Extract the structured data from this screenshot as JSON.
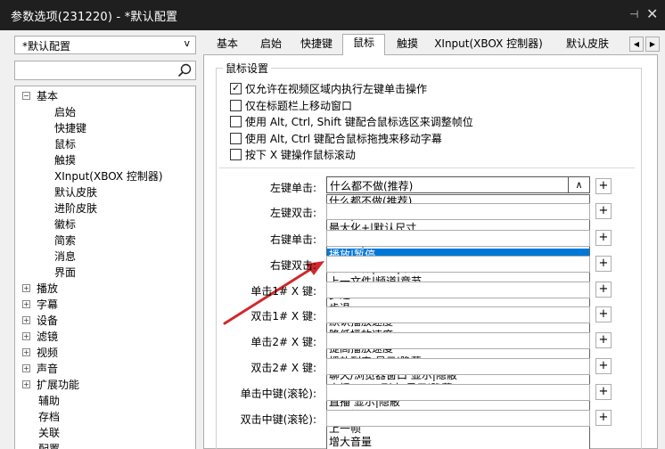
{
  "window": {
    "title": "参数选项(231220) - *默认配置",
    "pin_glyph": "⊣",
    "close_glyph": "✕"
  },
  "left": {
    "preset": "*默认配置",
    "search_placeholder": "",
    "tree": [
      {
        "label": "基本",
        "level": 0,
        "expander": "−"
      },
      {
        "label": "启始",
        "level": 2
      },
      {
        "label": "快捷键",
        "level": 2
      },
      {
        "label": "鼠标",
        "level": 2
      },
      {
        "label": "触摸",
        "level": 2
      },
      {
        "label": "XInput(XBOX 控制器)",
        "level": 2
      },
      {
        "label": "默认皮肤",
        "level": 2
      },
      {
        "label": "进阶皮肤",
        "level": 2
      },
      {
        "label": "徽标",
        "level": 2
      },
      {
        "label": "简索",
        "level": 2
      },
      {
        "label": "消息",
        "level": 2
      },
      {
        "label": "界面",
        "level": 2
      },
      {
        "label": "播放",
        "level": 0,
        "expander": "+"
      },
      {
        "label": "字幕",
        "level": 0,
        "expander": "+"
      },
      {
        "label": "设备",
        "level": 0,
        "expander": "+"
      },
      {
        "label": "滤镜",
        "level": 0,
        "expander": "+"
      },
      {
        "label": "视频",
        "level": 0,
        "expander": "+"
      },
      {
        "label": "声音",
        "level": 0,
        "expander": "+"
      },
      {
        "label": "扩展功能",
        "level": 0,
        "expander": "+"
      },
      {
        "label": "辅助",
        "level": 1
      },
      {
        "label": "存档",
        "level": 1
      },
      {
        "label": "关联",
        "level": 1
      },
      {
        "label": "配置",
        "level": 1
      }
    ]
  },
  "tabs": [
    {
      "label": "基本",
      "active": false
    },
    {
      "label": "启始",
      "active": false
    },
    {
      "label": "快捷键",
      "active": false
    },
    {
      "label": "鼠标",
      "active": true
    },
    {
      "label": "触摸",
      "active": false
    },
    {
      "label": "XInput(XBOX 控制器)",
      "active": false
    },
    {
      "label": "默认皮肤",
      "active": false
    }
  ],
  "tab_scroll": {
    "left": "◀",
    "right": "▶"
  },
  "mouse": {
    "group_title": "鼠标设置",
    "checkboxes": [
      {
        "label": "仅允许在视频区域内执行左键单击操作",
        "checked": true
      },
      {
        "label": "仅在标题栏上移动窗口",
        "checked": false
      },
      {
        "label": "使用 Alt, Ctrl, Shift 键配合鼠标选区来调整帧位",
        "checked": false
      },
      {
        "label": "使用 Alt, Ctrl 键配合鼠标拖拽来移动字幕",
        "checked": false
      },
      {
        "label": "按下 X 键操作鼠标滚动",
        "checked": false
      }
    ],
    "fields": [
      {
        "label": "左键单击:"
      },
      {
        "label": "左键双击:"
      },
      {
        "label": "右键单击:"
      },
      {
        "label": "右键双击:"
      },
      {
        "label": "单击1# X 键:"
      },
      {
        "label": "双击1# X 键:"
      },
      {
        "label": "单击2# X 键:"
      },
      {
        "label": "双击2# X 键:"
      },
      {
        "label": "单击中键(滚轮):"
      },
      {
        "label": "双击中键(滚轮):"
      }
    ],
    "plus_label": "+",
    "open_combo": {
      "value": "什么都不做(推荐)",
      "arrow": "∧",
      "selected_index": 4,
      "options": [
        "什么都不做(推荐)",
        "全屏|默认尺寸",
        "最大化+|默认尺寸",
        "最大化|默认尺寸",
        "播放|暂停",
        "下一文件|频道|章节",
        "上一文件|频道|章节",
        "步进",
        "步退",
        "默认播放速度",
        "降低播放速度",
        "提高播放速度",
        "播放列表 显示|隐蔽",
        "聊天/浏览器窗口 显示|隐蔽",
        "直播/VOD 列表 显示|隐蔽",
        "直播 显示|隐蔽",
        "下一帧",
        "上一帧",
        "增大音量"
      ]
    }
  },
  "colors": {
    "titlebar": "#1f1f1f",
    "selection": "#0078d7",
    "arrow": "#d0282c"
  }
}
